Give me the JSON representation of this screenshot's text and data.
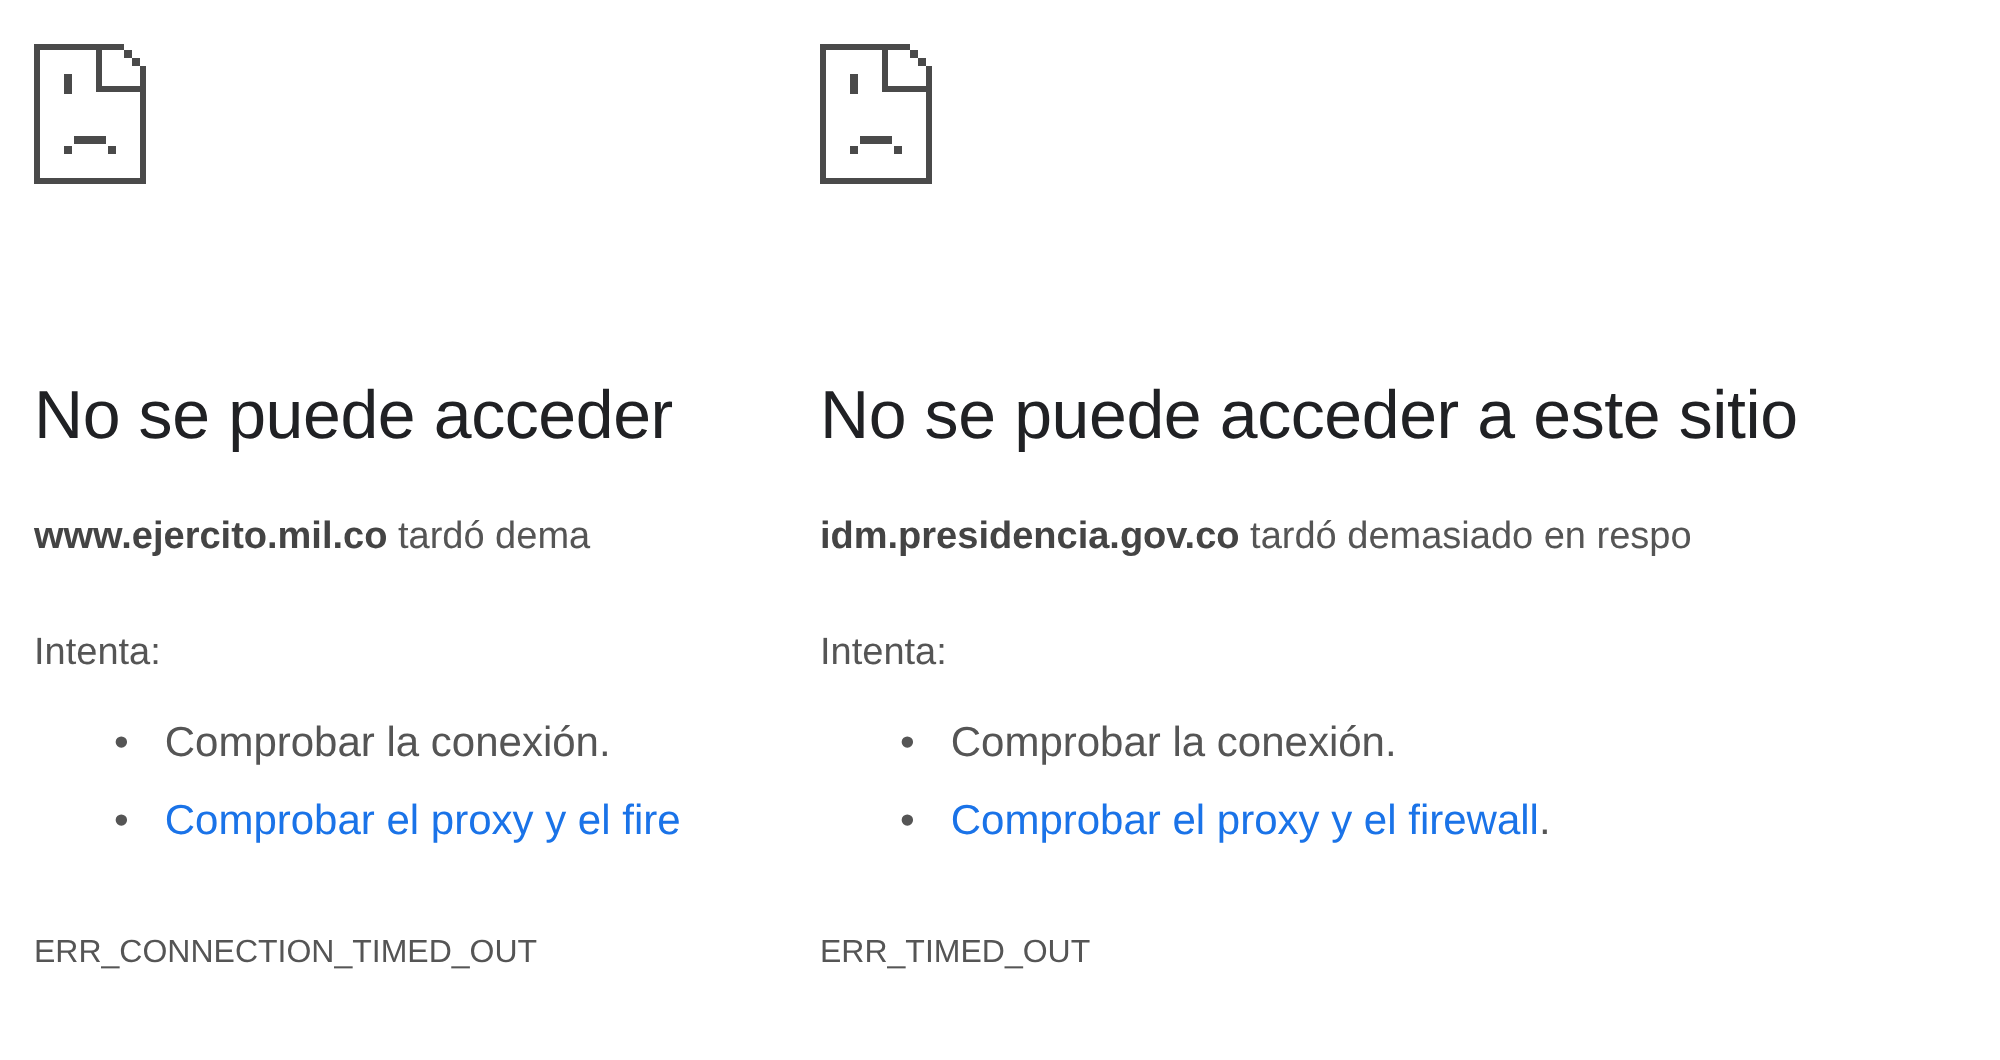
{
  "panels": [
    {
      "title": "No se puede acceder",
      "host": "www.ejercito.mil.co",
      "message": "tardó dema",
      "try_label": "Intenta:",
      "suggestions": [
        {
          "kind": "plain",
          "bullet": "•",
          "text": "Comprobar la conexión."
        },
        {
          "kind": "link",
          "bullet": "•",
          "text": "Comprobar el proxy y el fire"
        }
      ],
      "error_code": "ERR_CONNECTION_TIMED_OUT"
    },
    {
      "title": "No se puede acceder a este sitio",
      "host": "idm.presidencia.gov.co",
      "message": "tardó demasiado en respo",
      "try_label": "Intenta:",
      "suggestions": [
        {
          "kind": "plain",
          "bullet": "•",
          "text": "Comprobar la conexión."
        },
        {
          "kind": "link",
          "bullet": "•",
          "text": "Comprobar el proxy y el firewall",
          "suffix": "."
        }
      ],
      "error_code": "ERR_TIMED_OUT"
    }
  ]
}
